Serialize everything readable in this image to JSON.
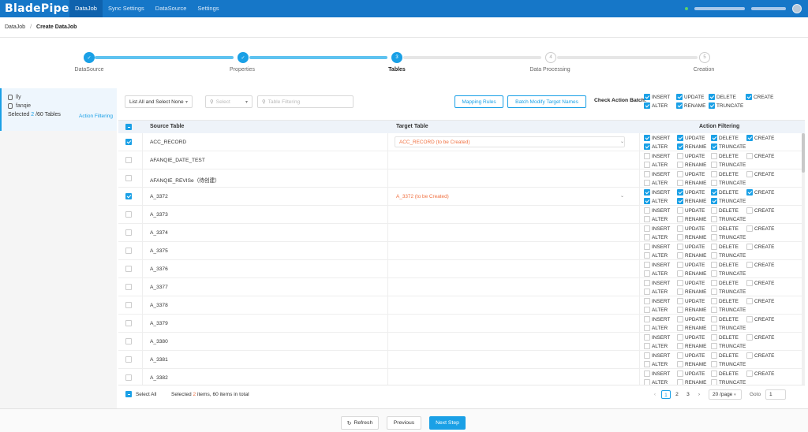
{
  "app": {
    "logo": "BladePipe",
    "nav": [
      "DataJob",
      "Sync Settings",
      "DataSource",
      "Settings"
    ]
  },
  "breadcrumb": {
    "root": "DataJob",
    "sep": "/",
    "current": "Create DataJob"
  },
  "steps": [
    {
      "label": "DataSource",
      "state": "done",
      "num": ""
    },
    {
      "label": "Properties",
      "state": "done",
      "num": ""
    },
    {
      "label": "Tables",
      "state": "active",
      "num": "3"
    },
    {
      "label": "Data Processing",
      "state": "todo",
      "num": "4"
    },
    {
      "label": "Creation",
      "state": "todo",
      "num": "5"
    }
  ],
  "left": {
    "databases": [
      "lly",
      "fanqie"
    ],
    "selected_prefix": "Selected",
    "selected_count": "2",
    "selected_suffix": "/60 Tables",
    "action_filtering": "Action Filtering"
  },
  "toolbar": {
    "list_select": "List All and Select None",
    "select_placeholder": "Select",
    "filter_placeholder": "Table Filtering",
    "mapping_rules": "Mapping Rules",
    "batch_modify": "Batch Modify Target Names",
    "check_action_batch": "Check Action Batch:",
    "batch_actions": [
      {
        "label": "INSERT",
        "checked": true
      },
      {
        "label": "UPDATE",
        "checked": true
      },
      {
        "label": "DELETE",
        "checked": true
      },
      {
        "label": "CREATE",
        "checked": true
      },
      {
        "label": "ALTER",
        "checked": true
      },
      {
        "label": "RENAME",
        "checked": true
      },
      {
        "label": "TRUNCATE",
        "checked": true
      }
    ]
  },
  "table": {
    "headers": {
      "source": "Source Table",
      "target": "Target Table",
      "action": "Action Filtering"
    },
    "action_labels": [
      "INSERT",
      "UPDATE",
      "DELETE",
      "CREATE",
      "ALTER",
      "RENAME",
      "TRUNCATE"
    ],
    "rows": [
      {
        "source": "ACC_RECORD",
        "selected": true,
        "target": "ACC_RECORD (to be Created)",
        "target_style": "box"
      },
      {
        "source": "AFANQIE_DATE_TEST",
        "selected": false,
        "target": "",
        "target_style": ""
      },
      {
        "source": "AFANQIE_REVISe（待创建）",
        "selected": false,
        "target": "",
        "target_style": ""
      },
      {
        "source": "A_3372",
        "selected": true,
        "target": "A_3372 (to be Created)",
        "target_style": "plain"
      },
      {
        "source": "A_3373",
        "selected": false,
        "target": "",
        "target_style": ""
      },
      {
        "source": "A_3374",
        "selected": false,
        "target": "",
        "target_style": ""
      },
      {
        "source": "A_3375",
        "selected": false,
        "target": "",
        "target_style": ""
      },
      {
        "source": "A_3376",
        "selected": false,
        "target": "",
        "target_style": ""
      },
      {
        "source": "A_3377",
        "selected": false,
        "target": "",
        "target_style": ""
      },
      {
        "source": "A_3378",
        "selected": false,
        "target": "",
        "target_style": ""
      },
      {
        "source": "A_3379",
        "selected": false,
        "target": "",
        "target_style": ""
      },
      {
        "source": "A_3380",
        "selected": false,
        "target": "",
        "target_style": ""
      },
      {
        "source": "A_3381",
        "selected": false,
        "target": "",
        "target_style": ""
      },
      {
        "source": "A_3382",
        "selected": false,
        "target": "",
        "target_style": ""
      }
    ]
  },
  "footer": {
    "select_all": "Select All",
    "sel_prefix": "Selected",
    "sel_count": "2",
    "sel_suffix": "items, 60 items in total",
    "pages": [
      "1",
      "2",
      "3"
    ],
    "current_page": "1",
    "per_page": "20 /page",
    "goto_label": "Goto",
    "goto_value": "1"
  },
  "actions": {
    "refresh": "Refresh",
    "previous": "Previous",
    "next": "Next Step"
  },
  "colors": {
    "accent": "#1aa0e6",
    "nav_bg": "#1677c8",
    "warn_text": "#f07040"
  }
}
